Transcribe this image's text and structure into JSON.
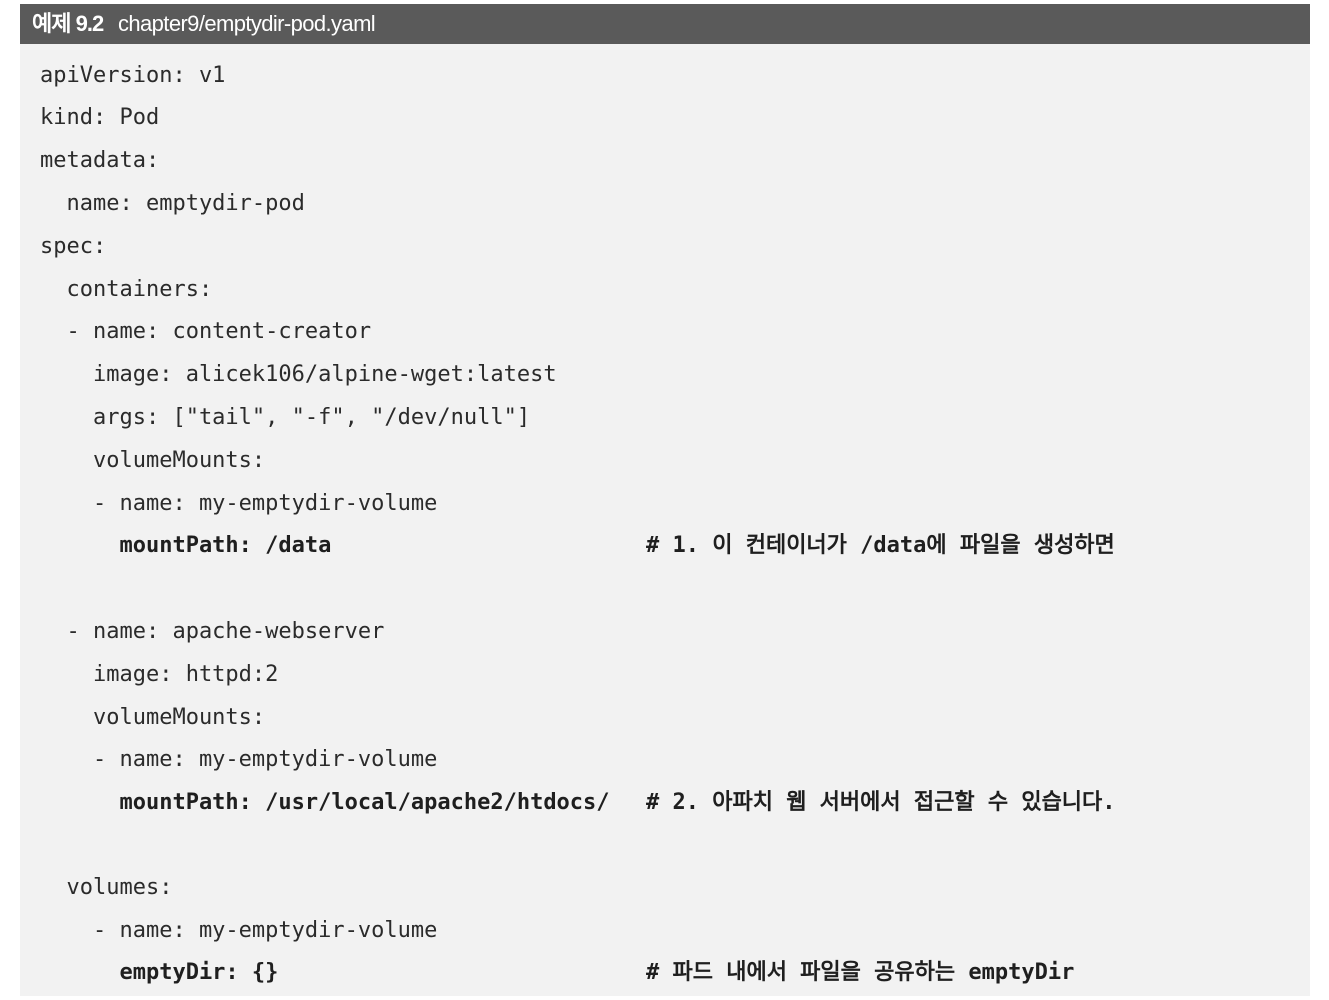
{
  "header": {
    "label": "예제 9.2",
    "filename": "chapter9/emptydir-pod.yaml"
  },
  "code": {
    "lines": [
      "apiVersion: v1",
      "kind: Pod",
      "metadata:",
      "  name: emptydir-pod",
      "spec:",
      "  containers:",
      "  - name: content-creator",
      "    image: alicek106/alpine-wget:latest",
      "    args: [\"tail\", \"-f\", \"/dev/null\"]",
      "    volumeMounts:",
      "    - name: my-emptydir-volume",
      "      mountPath: /data",
      "  - name: apache-webserver",
      "    image: httpd:2",
      "    volumeMounts:",
      "    - name: my-emptydir-volume",
      "      mountPath: /usr/local/apache2/htdocs/",
      "  volumes:",
      "    - name: my-emptydir-volume",
      "      emptyDir: {}"
    ],
    "comments": [
      "# 1. 이 컨테이너가 /data에 파일을 생성하면",
      "# 2. 아파치 웹 서버에서 접근할 수 있습니다.",
      "# 파드 내에서 파일을 공유하는 emptyDir"
    ]
  }
}
